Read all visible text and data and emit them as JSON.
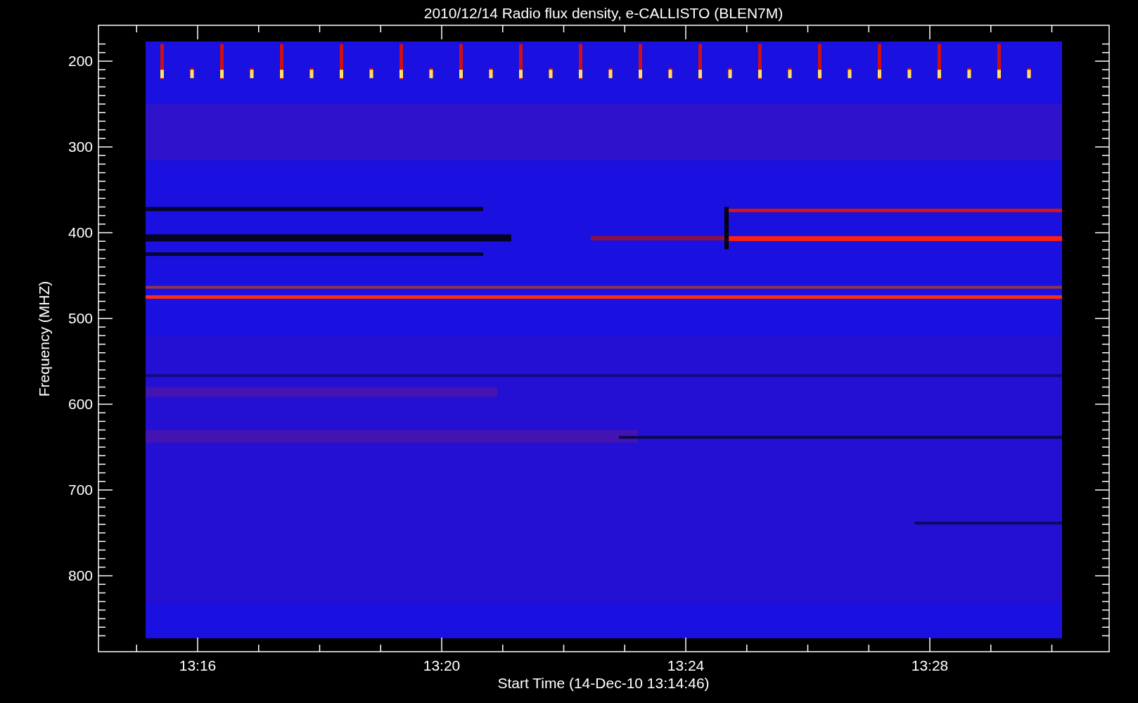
{
  "title": "2010/12/14  Radio flux density, e-CALLISTO (BLEN7M)",
  "y_axis": {
    "label": "Frequency (MHZ)",
    "ticks": [
      "200",
      "300",
      "400",
      "500",
      "600",
      "700",
      "800"
    ]
  },
  "x_axis": {
    "label": "Start Time (14-Dec-10 13:14:46)",
    "ticks": [
      "13:16",
      "13:20",
      "13:24",
      "13:28"
    ]
  }
}
